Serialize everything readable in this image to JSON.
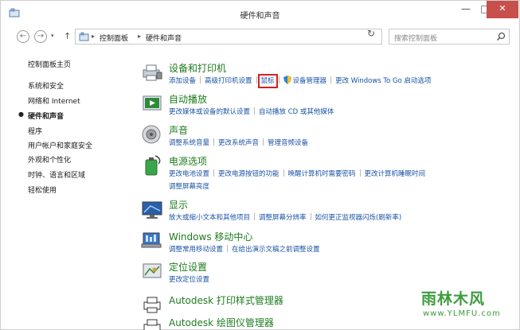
{
  "window": {
    "title": "硬件和声音",
    "min_glyph": "—",
    "max_glyph": "□",
    "close_glyph": "✕"
  },
  "nav": {
    "back_glyph": "←",
    "forward_glyph": "→",
    "recent_glyph": "▾",
    "up_glyph": "↑",
    "refresh_glyph": "↻",
    "breadcrumb": [
      "控制面板",
      "硬件和声音"
    ],
    "separator": "▸",
    "dropdown_glyph": "▾",
    "search_placeholder": "搜索控制面板"
  },
  "sidebar": {
    "items": [
      {
        "label": "控制面板主页"
      },
      {
        "label": "系统和安全"
      },
      {
        "label": "网络和 Internet"
      },
      {
        "label": "硬件和声音",
        "active": true
      },
      {
        "label": "程序"
      },
      {
        "label": "用户帐户和家庭安全"
      },
      {
        "label": "外观和个性化"
      },
      {
        "label": "时钟、语言和区域"
      },
      {
        "label": "轻松使用"
      }
    ],
    "bullet": "●"
  },
  "categories": [
    {
      "title": "设备和打印机",
      "icon": "printer-icon",
      "links": [
        "添加设备",
        "高级打印机设置",
        "鼠标",
        "设备管理器",
        "更改 Windows To Go 启动选项"
      ]
    },
    {
      "title": "自动播放",
      "icon": "autoplay-icon",
      "links": [
        "更改媒体或设备的默认设置",
        "自动播放 CD 或其他媒体"
      ]
    },
    {
      "title": "声音",
      "icon": "speaker-icon",
      "links": [
        "调整系统音量",
        "更改系统声音",
        "管理音频设备"
      ]
    },
    {
      "title": "电源选项",
      "icon": "battery-icon",
      "links": [
        "更改电池设置",
        "更改电源按钮的功能",
        "唤醒计算机时需要密码",
        "更改计算机睡眠时间"
      ],
      "links2": [
        "调整屏幕亮度"
      ]
    },
    {
      "title": "显示",
      "icon": "display-icon",
      "links": [
        "放大或缩小文本和其他项目",
        "调整屏幕分辨率",
        "如何更正监视器闪烁(刷新率)"
      ]
    },
    {
      "title": "Windows 移动中心",
      "icon": "mobility-center-icon",
      "links": [
        "调整常用移动设置",
        "在给出演示文稿之前调整设置"
      ]
    },
    {
      "title": "定位设置",
      "icon": "location-icon",
      "links": [
        "更改定位设置"
      ]
    },
    {
      "title": "Autodesk 打印样式管理器",
      "icon": "autodesk-print-icon",
      "links": []
    },
    {
      "title": "Autodesk 绘图仪管理器",
      "icon": "autodesk-plotter-icon",
      "links": []
    }
  ],
  "watermark": {
    "text": "雨林木风",
    "sub": "www.YLMFU.com"
  },
  "colors": {
    "link": "#1a52a6",
    "category_title": "#1e7c1e",
    "highlight": "#d3211f",
    "close_button": "#c7504d"
  }
}
